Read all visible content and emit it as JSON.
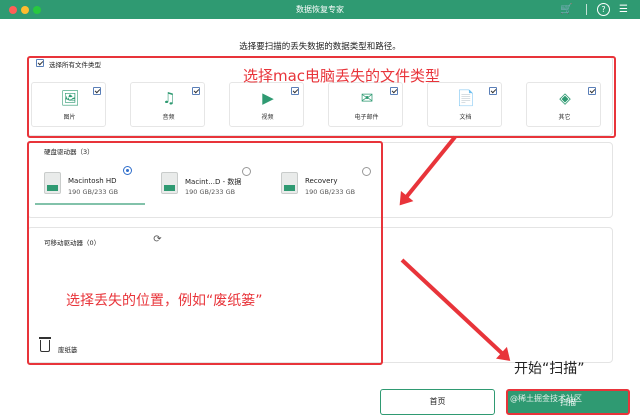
{
  "window": {
    "title": "数据恢复专家"
  },
  "heading": "选择要扫描的丢失数据的数据类型和路径。",
  "file_types": {
    "select_all_label": "选择所有文件类型",
    "items": [
      {
        "label": "图片",
        "icon": "image-icon"
      },
      {
        "label": "音频",
        "icon": "music-icon"
      },
      {
        "label": "视频",
        "icon": "video-icon"
      },
      {
        "label": "电子邮件",
        "icon": "mail-icon"
      },
      {
        "label": "文档",
        "icon": "document-icon"
      },
      {
        "label": "其它",
        "icon": "other-icon"
      }
    ]
  },
  "hard_drives": {
    "title": "硬盘驱动器（3）",
    "disks": [
      {
        "name": "Macintosh HD",
        "size": "190 GB/233 GB",
        "selected": true
      },
      {
        "name": "Macint...D - 数据",
        "size": "190 GB/233 GB",
        "selected": false
      },
      {
        "name": "Recovery",
        "size": "190 GB/233 GB",
        "selected": false
      }
    ]
  },
  "removable": {
    "title": "可移动驱动器（0）"
  },
  "trash": {
    "label": "废纸篓"
  },
  "annotations": {
    "types": "选择mac电脑丢失的文件类型",
    "location": "选择丢失的位置，例如“废纸篓”",
    "scan": "开始“扫描”",
    "watermark": "@稀土掘金技术社区"
  },
  "buttons": {
    "home": "首页",
    "scan": "扫描"
  },
  "colors": {
    "brand": "#2f9a72",
    "annotation": "#e8343a"
  }
}
